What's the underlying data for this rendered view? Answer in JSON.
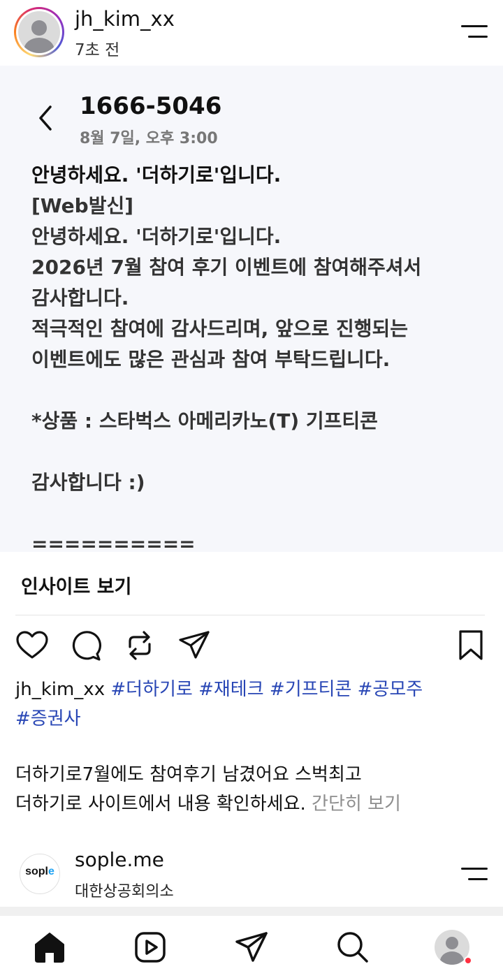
{
  "post": {
    "username": "jh_kim_xx",
    "time_ago": "7초 전"
  },
  "sms": {
    "sender": "1666-5046",
    "sent_time": "8월 7일, 오후 3:00",
    "lines": [
      "안녕하세요. '더하기로'입니다.",
      "[Web발신]",
      "안녕하세요. '더하기로'입니다.",
      "2026년 7월 참여 후기 이벤트에 참여해주셔서",
      "감사합니다.",
      "적극적인 참여에 감사드리며, 앞으로 진행되는",
      "이벤트에도 많은 관심과 참여 부탁드립니다.",
      "",
      "*상품 : 스타벅스 아메리카노(T) 기프티콘",
      "",
      "감사합니다 :)",
      "",
      "=========="
    ]
  },
  "insights_label": "인사이트 보기",
  "caption": {
    "username": "jh_kim_xx",
    "hashtags": [
      "#더하기로",
      "#재테크",
      "#기프티콘",
      "#공모주",
      "#증권사"
    ],
    "body_line1": "더하기로7월에도 참여후기 남겼어요 스벅최고",
    "body_line2": "더하기로 사이트에서 내용 확인하세요.",
    "more": "간단히 보기"
  },
  "next_post": {
    "username": "sople.me",
    "subtitle": "대한상공회의소",
    "logo_text": "sopl",
    "logo_accent": "e"
  },
  "icons": {
    "actions": [
      "heart-icon",
      "comment-icon",
      "repost-icon",
      "share-icon",
      "bookmark-icon"
    ],
    "nav": [
      "home-icon",
      "reels-icon",
      "direct-message-icon",
      "search-icon",
      "profile-avatar"
    ]
  },
  "colors": {
    "hashtag": "#2846b5",
    "more_link": "#8e8e8e",
    "card_bg": "#f6f7fb",
    "notification_dot": "#ff3040"
  }
}
